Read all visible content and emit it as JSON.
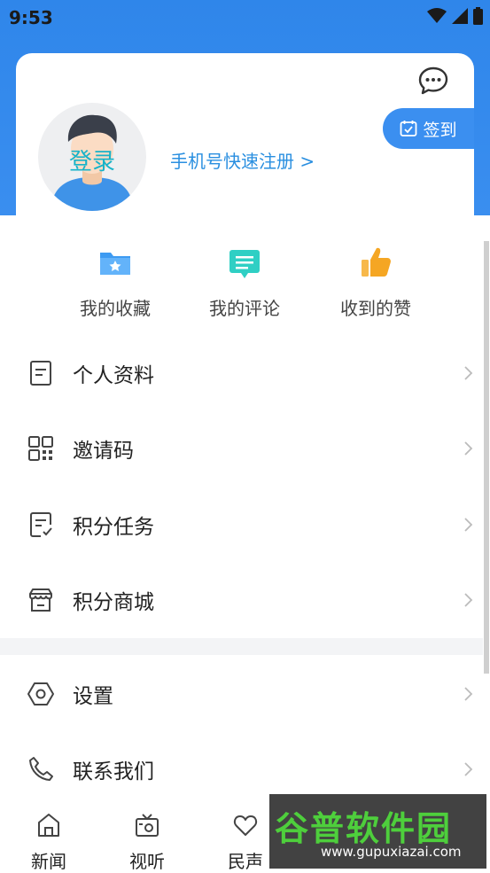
{
  "status_bar": {
    "time": "9:53"
  },
  "profile": {
    "login_label": "登录",
    "register_link": "手机号快速注册 >",
    "checkin_label": "签到"
  },
  "quick_actions": [
    {
      "label": "我的收藏",
      "icon": "folder-star-icon",
      "color": "#3d9bf2"
    },
    {
      "label": "我的评论",
      "icon": "comment-icon",
      "color": "#2fcfc4"
    },
    {
      "label": "收到的赞",
      "icon": "thumbs-up-icon",
      "color": "#f5a623"
    }
  ],
  "menu": [
    {
      "label": "个人资料",
      "icon": "profile-doc-icon"
    },
    {
      "label": "邀请码",
      "icon": "qr-code-icon"
    },
    {
      "label": "积分任务",
      "icon": "task-check-icon"
    },
    {
      "label": "积分商城",
      "icon": "store-icon"
    }
  ],
  "menu_secondary": [
    {
      "label": "设置",
      "icon": "settings-hex-icon"
    },
    {
      "label": "联系我们",
      "icon": "phone-icon"
    }
  ],
  "tab_bar": [
    {
      "label": "新闻",
      "icon": "home-icon"
    },
    {
      "label": "视听",
      "icon": "tv-icon"
    },
    {
      "label": "民声",
      "icon": "heart-icon"
    }
  ],
  "watermark": {
    "title": "谷普软件园",
    "url": "www.gupuxiazai.com"
  },
  "colors": {
    "brand_blue": "#3b8ff0",
    "login_teal": "#17b3c9",
    "link_blue": "#2a8fe0"
  }
}
